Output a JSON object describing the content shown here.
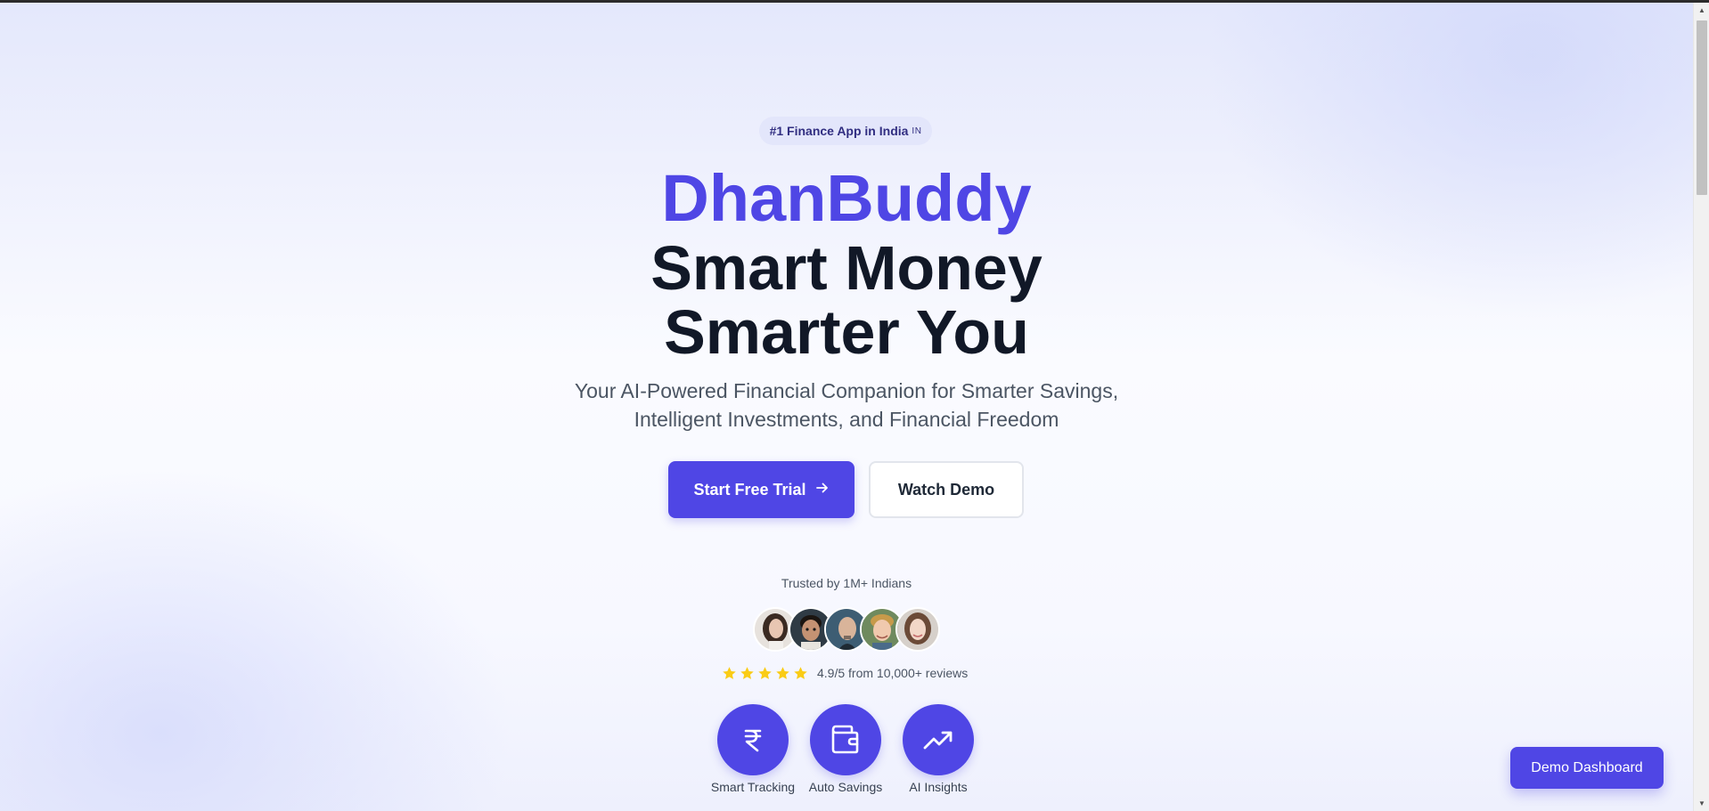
{
  "hero": {
    "badge_text": "#1 Finance App in India",
    "badge_flag": "IN",
    "brand": "DhanBuddy",
    "headline_line1": "Smart Money",
    "headline_line2": "Smarter You",
    "subtitle_line1": "Your AI-Powered Financial Companion for Smarter Savings,",
    "subtitle_line2": "Intelligent Investments, and Financial Freedom",
    "primary_cta": "Start Free Trial",
    "secondary_cta": "Watch Demo"
  },
  "social_proof": {
    "trusted_text": "Trusted by 1M+ Indians",
    "avatars": [
      "avatar-woman-dark-hair",
      "avatar-child",
      "avatar-man-bald",
      "avatar-boy-blond",
      "avatar-woman-brown-hair"
    ],
    "stars": 5,
    "rating_text": "4.9/5 from 10,000+ reviews"
  },
  "features": [
    {
      "label": "Smart Tracking",
      "icon": "rupee-icon"
    },
    {
      "label": "Auto Savings",
      "icon": "wallet-icon"
    },
    {
      "label": "AI Insights",
      "icon": "trending-up-icon"
    }
  ],
  "floating": {
    "demo_dashboard": "Demo Dashboard"
  },
  "colors": {
    "accent": "#4f46e5",
    "heading": "#111827",
    "star": "#facc15",
    "badge_bg": "#e3e6fb"
  }
}
